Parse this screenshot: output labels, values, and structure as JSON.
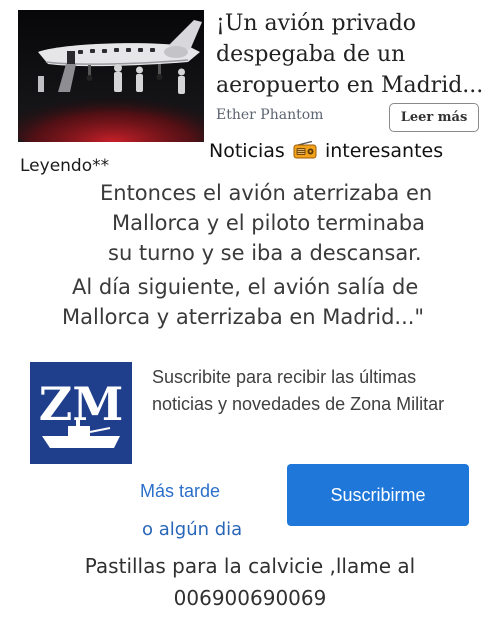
{
  "ad": {
    "title": "¡Un avión privado despegaba de un aeropuerto en Madrid...",
    "source": "Ether Phantom",
    "button_label": "Leer más"
  },
  "overlay": {
    "reading_label": "Leyendo**",
    "news_before": "Noticias",
    "news_icon": "radio-icon",
    "news_after": "interesantes",
    "story_lines": [
      "Entonces el avión aterrizaba  en",
      "Mallorca y el piloto terminaba",
      "su turno y se iba  a descansar.",
      "Al día siguiente, el avión salía de",
      "Mallorca y aterrizaba en Madrid...\""
    ]
  },
  "subscription": {
    "logo_text": "ZM",
    "message": "Suscribite para recibir las últimas noticias y novedades de Zona Militar",
    "later_label": "Más tarde",
    "subscribe_label": "Suscribirme",
    "someday_text": "o algún dia"
  },
  "footer": {
    "line1": "Pastillas para la calvicie ,llame al",
    "line2": "006900690069"
  },
  "colors": {
    "primary_blue": "#1e77d9",
    "link_blue": "#2a6fc9",
    "logo_blue": "#1f3f8c"
  }
}
